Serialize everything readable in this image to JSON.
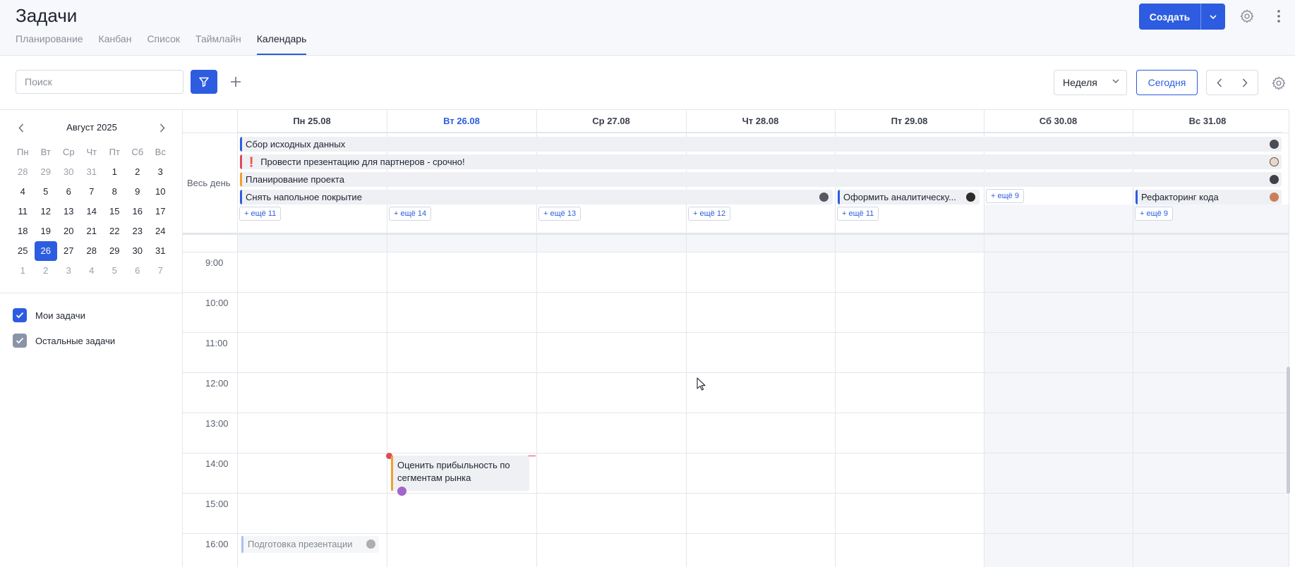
{
  "header": {
    "title": "Задачи",
    "tabs": [
      {
        "label": "Планирование"
      },
      {
        "label": "Канбан"
      },
      {
        "label": "Список"
      },
      {
        "label": "Таймлайн"
      },
      {
        "label": "Календарь",
        "active": true
      }
    ],
    "create_label": "Создать"
  },
  "toolbar": {
    "search_placeholder": "Поиск",
    "view_select": "Неделя",
    "today_label": "Сегодня"
  },
  "mini_calendar": {
    "month_label": "Август 2025",
    "weekdays": [
      "Пн",
      "Вт",
      "Ср",
      "Чт",
      "Пт",
      "Сб",
      "Вс"
    ],
    "weeks": [
      [
        "28",
        "29",
        "30",
        "31",
        "1",
        "2",
        "3"
      ],
      [
        "4",
        "5",
        "6",
        "7",
        "8",
        "9",
        "10"
      ],
      [
        "11",
        "12",
        "13",
        "14",
        "15",
        "16",
        "17"
      ],
      [
        "18",
        "19",
        "20",
        "21",
        "22",
        "23",
        "24"
      ],
      [
        "25",
        "26",
        "27",
        "28",
        "29",
        "30",
        "31"
      ],
      [
        "1",
        "2",
        "3",
        "4",
        "5",
        "6",
        "7"
      ]
    ],
    "selected_day": "26"
  },
  "filters": [
    {
      "label": "Мои задачи",
      "checked": true,
      "color": "#2d5ce0"
    },
    {
      "label": "Остальные задачи",
      "checked": true,
      "color": "#8a93a8"
    }
  ],
  "calendar": {
    "days": [
      {
        "label": "Пн 25.08",
        "today": false
      },
      {
        "label": "Вт 26.08",
        "today": true
      },
      {
        "label": "Ср 27.08",
        "today": false
      },
      {
        "label": "Чт 28.08",
        "today": false
      },
      {
        "label": "Пт 29.08",
        "today": false
      },
      {
        "label": "Сб 30.08",
        "today": false
      },
      {
        "label": "Вс 31.08",
        "today": false
      }
    ],
    "all_day_label": "Весь день",
    "all_day_events": [
      {
        "title": "Сбор исходных данных",
        "color": "#2d5ce0",
        "urgent": false
      },
      {
        "title": "Провести презентацию для партнеров - срочно!",
        "color": "#e0495a",
        "urgent": true,
        "urgent_mark": "❗"
      },
      {
        "title": "Планирование проекта",
        "color": "#f0a030",
        "urgent": false
      },
      {
        "title": "Снять напольное покрытие",
        "color": "#2d5ce0",
        "urgent": false
      },
      {
        "title": "Оформить аналитическу...",
        "color": "#2d5ce0",
        "urgent": false
      },
      {
        "title": "Рефакторинг кода",
        "color": "#2d5ce0",
        "urgent": false
      }
    ],
    "more": [
      "+ ещё 11",
      "+ ещё 14",
      "+ ещё 13",
      "+ ещё 12",
      "+ ещё 11",
      "+ ещё 9",
      "+ ещё 9"
    ],
    "hours": [
      "9:00",
      "10:00",
      "11:00",
      "12:00",
      "13:00",
      "14:00",
      "15:00",
      "16:00"
    ],
    "timed_events": [
      {
        "title": "Оценить прибыльность по сегментам рынка",
        "color": "#f0a030"
      },
      {
        "title": "Подготовка презентации",
        "color": "#6b8ee8"
      }
    ]
  },
  "colors": {
    "accent": "#2d5ce0",
    "now_line": "#e0495a"
  }
}
